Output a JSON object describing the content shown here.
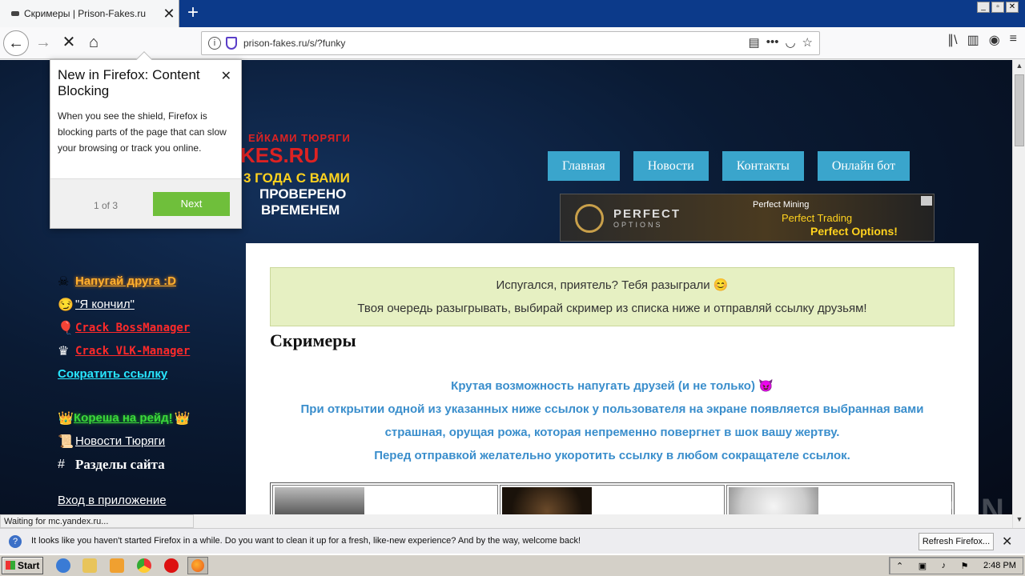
{
  "browser": {
    "tab_title": "Скримеры | Prison-Fakes.ru",
    "tab_close": "✕",
    "new_tab": "+",
    "url": "prison-fakes.ru/s/?funky",
    "window_controls": [
      "_",
      "▫",
      "✕"
    ]
  },
  "icons": {
    "back": "←",
    "forward": "→",
    "stop": "✕",
    "home": "⌂",
    "info": "i",
    "reader": "▤",
    "more": "•••",
    "pocket": "◡",
    "star": "☆",
    "library": "∥\\",
    "sidebar": "▥",
    "account": "◉",
    "menu": "≡"
  },
  "logo": {
    "line1": "ЕЙКАМИ ТЮРЯГИ",
    "line2": "KES.RU",
    "line3": "3 ГОДА С ВАМИ",
    "line4": "ПРОВЕРЕНО",
    "line5": "ВРЕМЕНЕМ"
  },
  "nav": [
    "Главная",
    "Новости",
    "Контакты",
    "Онлайн бот"
  ],
  "banner": {
    "brand": "PERFECT",
    "brand_sub": "OPTIONS",
    "line1": "Perfect Mining",
    "line2": "Perfect Trading",
    "line3": "Perfect Options!"
  },
  "sidebar": [
    {
      "icon": "☠",
      "label": "Напугай друга :D",
      "color": "#ffb02e"
    },
    {
      "icon": "😏",
      "label": "\"Я кончил\"",
      "color": "#ffffff"
    },
    {
      "icon": "🎈",
      "label": "Crack BossManager",
      "color": "#ff2a2a"
    },
    {
      "icon": "♛",
      "label": "Crack VLK-Manager",
      "color": "#ff2a2a"
    },
    {
      "icon": "",
      "label": "Сократить ссылку",
      "color": "#28e6ff"
    },
    {
      "icon": "👑",
      "label": "Кореша на рейд!",
      "icon_after": "👑",
      "color": "#3bd83b"
    },
    {
      "icon": "📜",
      "label": "Новости Тюряги",
      "color": "#ffffff"
    },
    {
      "icon": "#",
      "label": "Разделы сайта",
      "color": "#ffffff"
    },
    {
      "icon": "",
      "label": "Вход в приложение",
      "color": "#ffffff"
    }
  ],
  "notice": {
    "line1": "Испугался, приятель? Тебя разыграли 😊",
    "line2": "Твоя очередь разыгрывать, выбирай скример из списка ниже и отправляй ссылку друзьям!"
  },
  "heading": "Скримеры",
  "intro": [
    "Крутая возможность напугать друзей (и не только) 😈",
    "При открытии одной из указанных ниже ссылок у пользователя на экране появляется выбранная вами",
    "страшная, орущая рожа, которая непременно повергнет в шок вашу жертву.",
    "Перед отправкой желательно укоротить ссылку в любом сокращателе ссылок."
  ],
  "status_text": "Waiting for mc.yandex.ru...",
  "popup": {
    "title": "New in Firefox: Content Blocking",
    "close": "✕",
    "body": "When you see the shield, Firefox is blocking parts of the page that can slow your browsing or track you online.",
    "counter": "1 of 3",
    "next": "Next"
  },
  "notification": {
    "icon": "?",
    "text": "It looks like you haven't started Firefox in a while. Do you want to clean it up for a fresh, like-new experience? And by the way, welcome back!",
    "button": "Refresh Firefox...",
    "close": "✕"
  },
  "watermark": "ANY▷RUN",
  "taskbar": {
    "start": "Start",
    "clock": "2:48 PM"
  }
}
